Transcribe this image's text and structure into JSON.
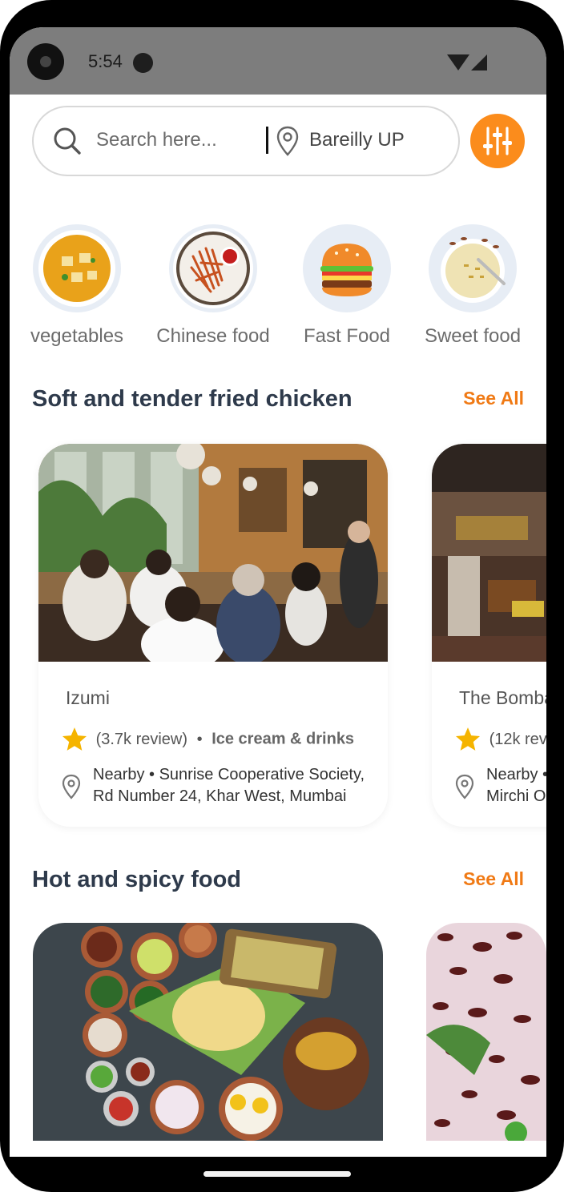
{
  "status_bar": {
    "time": "5:54"
  },
  "search": {
    "placeholder": "Search here...",
    "location": "Bareilly UP"
  },
  "categories": [
    {
      "label": "vegetables",
      "icon": "vegetable-curry-bowl"
    },
    {
      "label": "Chinese food",
      "icon": "noodles-plate"
    },
    {
      "label": "Fast Food",
      "icon": "burger-icon"
    },
    {
      "label": "Sweet food",
      "icon": "sweet-dessert-bowl"
    }
  ],
  "sections": [
    {
      "title": "Soft and tender fried chicken",
      "see_all": "See All",
      "restaurants": [
        {
          "name": "Izumi",
          "review": "(3.7k review)",
          "separator": "•",
          "category": "Ice cream & drinks",
          "address_line1": "Nearby • Sunrise Cooperative Society,",
          "address_line2": "Rd Number 24, Khar West, Mumbai"
        },
        {
          "name": "The Bomba",
          "review": "(12k rev",
          "address_line1": "Nearby •",
          "address_line2": "Mirchi O"
        }
      ]
    },
    {
      "title": "Hot and spicy food",
      "see_all": "See All"
    }
  ],
  "colors": {
    "accent": "#fb8c1c",
    "see_all": "#f07a15",
    "title": "#2e3a4b",
    "star": "#f5b400"
  }
}
